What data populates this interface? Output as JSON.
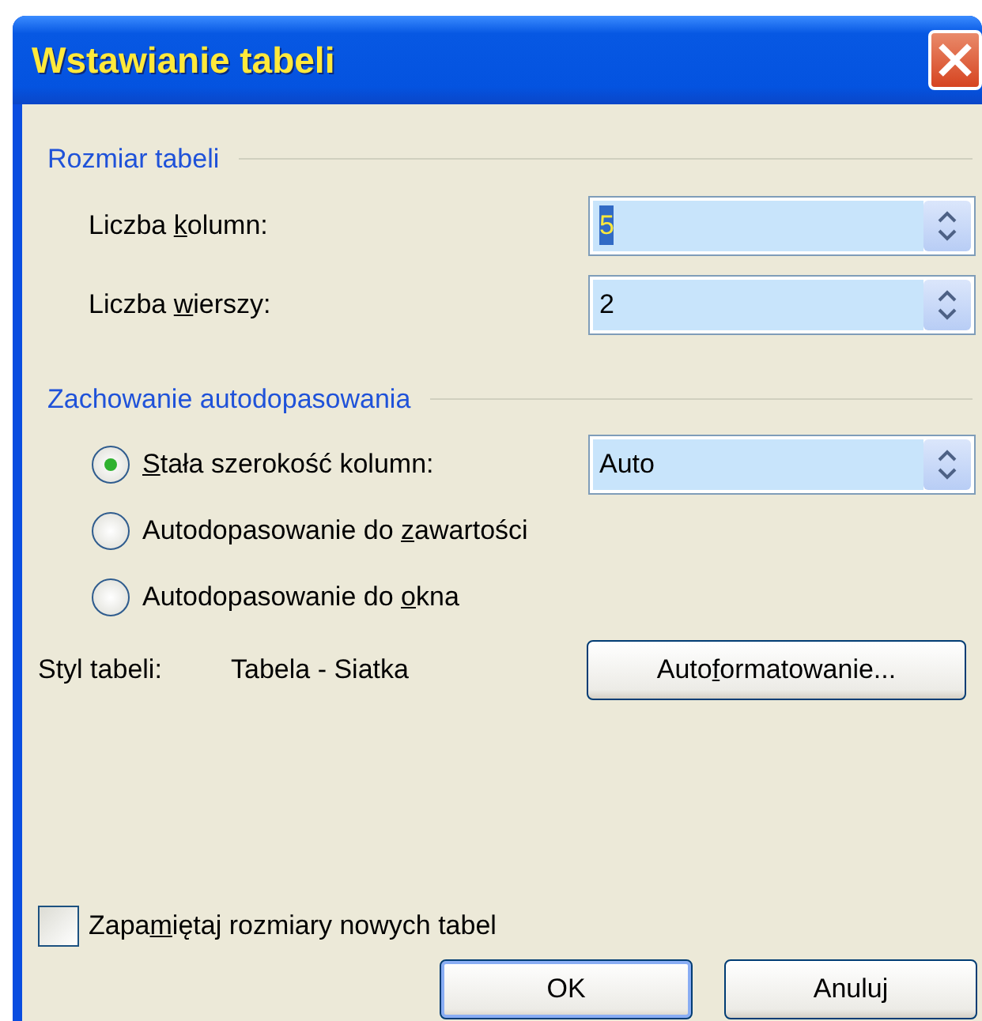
{
  "window": {
    "title": "Wstawianie tabeli"
  },
  "table_size": {
    "title": "Rozmiar tabeli",
    "fields": [
      {
        "label_pre": "Liczba ",
        "access_key": "k",
        "label_post": "olumn:",
        "value": "5",
        "text_selected": true
      },
      {
        "label_pre": "Liczba ",
        "access_key": "w",
        "label_post": "ierszy:",
        "value": "2",
        "text_selected": false
      }
    ]
  },
  "autofit": {
    "title": "Zachowanie autodopasowania",
    "options": [
      {
        "access_key": "S",
        "label_post": "tała szerokość kolumn:",
        "selected": true,
        "width_value": "Auto"
      },
      {
        "label_pre": "Autodopasowanie do ",
        "access_key": "z",
        "label_post": "awartości",
        "selected": false
      },
      {
        "label_pre": "Autodopasowanie do ",
        "access_key": "o",
        "label_post": "kna",
        "selected": false
      }
    ]
  },
  "table_style": {
    "label": "Styl tabeli:",
    "value": "Tabela - Siatka",
    "button": {
      "label_pre": "Auto",
      "access_key": "f",
      "label_post": "ormatowanie..."
    }
  },
  "remember_checkbox": {
    "label_pre": "Zapa",
    "access_key": "m",
    "label_post": "iętaj rozmiary nowych tabel",
    "checked": false
  },
  "buttons": [
    {
      "label": "OK",
      "default": true
    },
    {
      "label": "Anuluj",
      "default": false
    }
  ]
}
